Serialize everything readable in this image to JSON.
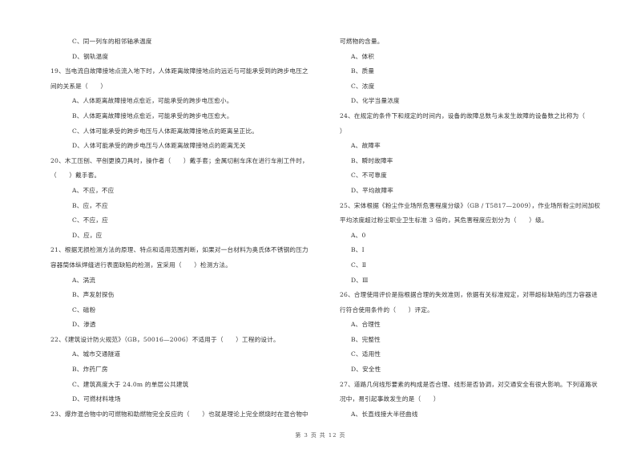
{
  "left_column": [
    {
      "type": "option",
      "text": "C、同一列车的相邻轴承温度"
    },
    {
      "type": "option",
      "text": "D、钢轨温度"
    },
    {
      "type": "question",
      "text": "19、当电流自故障接地点流入地下时，人体距离故障接地点的远近与可能承受到的跨步电压之"
    },
    {
      "type": "question",
      "text": "间的关系是（　　）"
    },
    {
      "type": "option",
      "text": "A、人体距离故障接地点愈近，可能承受的跨步电压愈小。"
    },
    {
      "type": "option",
      "text": "B、人体距离故障接地点愈近，可能承受的跨步电压愈大。"
    },
    {
      "type": "option",
      "text": "C、人体可能承受的跨步电压与人体距离故障接地点的距离呈正比。"
    },
    {
      "type": "option",
      "text": "D、人体可能承受的跨步电压与人体距离故障接地点的距离无关"
    },
    {
      "type": "question",
      "text": "20、木工压刨、平刨更换刀具时，操作者（　　）戴手套；金属切削车床在进行车削工件时，"
    },
    {
      "type": "question",
      "text": "（　　）戴手套。"
    },
    {
      "type": "option",
      "text": "A、不应，不应"
    },
    {
      "type": "option",
      "text": "B、应，不应"
    },
    {
      "type": "option",
      "text": "C、不应，应"
    },
    {
      "type": "option",
      "text": "D、应，应"
    },
    {
      "type": "question",
      "text": "21、根据无损检测方法的原理、特点和适用范围判断，如果对一台材料为奥氏体不锈钢的压力"
    },
    {
      "type": "question",
      "text": "容器筒体纵焊缝进行表面缺陷的检测，宜采用（　　）检测方法。"
    },
    {
      "type": "option",
      "text": "A、涡流"
    },
    {
      "type": "option",
      "text": "B、声发射探伤"
    },
    {
      "type": "option",
      "text": "C、磁粉"
    },
    {
      "type": "option",
      "text": "D、渗透"
    },
    {
      "type": "question",
      "text": "22、《建筑设计防火规范》（GB，50016—2006）不适用于（　　）工程的设计。"
    },
    {
      "type": "option",
      "text": "A、城市交通隧道"
    },
    {
      "type": "option",
      "text": "B、炸药厂房"
    },
    {
      "type": "option",
      "text": "C、建筑高度大于 24.0m 的单层公共建筑"
    },
    {
      "type": "option",
      "text": "D、可燃材料堆场"
    },
    {
      "type": "question",
      "text": "23、爆炸混合物中的可燃物和助燃物完全反应的（　　）也就是理论上完全燃烧时在混合物中"
    }
  ],
  "right_column": [
    {
      "type": "question",
      "text": "可燃物的含量。"
    },
    {
      "type": "option",
      "text": "A、体积"
    },
    {
      "type": "option",
      "text": "B、质量"
    },
    {
      "type": "option",
      "text": "C、浓度"
    },
    {
      "type": "option",
      "text": "D、化学当量浓度"
    },
    {
      "type": "question",
      "text": "24、在规定的条件下和规定的时间内，设备的故障总数与未发生故障的设备数之比称为（"
    },
    {
      "type": "question",
      "text": "）"
    },
    {
      "type": "option",
      "text": "A、故障率"
    },
    {
      "type": "option",
      "text": "B、瞬时故障率"
    },
    {
      "type": "option",
      "text": "C、不可靠度"
    },
    {
      "type": "option",
      "text": "D、平均故障率"
    },
    {
      "type": "question",
      "text": "25、宋体根据《粉尘作业场所危害程度分级》（GB / T5817—2009），作业场所粉尘时间加权"
    },
    {
      "type": "question",
      "text": "平均浓度超过粉尘职业卫生标准 3 倍的，其危害程度应划分为（　　）级。"
    },
    {
      "type": "option",
      "text": "A、0"
    },
    {
      "type": "option",
      "text": "B、Ⅰ"
    },
    {
      "type": "option",
      "text": "C、Ⅱ"
    },
    {
      "type": "option",
      "text": "D、Ⅲ"
    },
    {
      "type": "question",
      "text": "26、合理使用评价是指根据合理的失效准则，依据有关标准规定，对带超标缺陷的压力容器进"
    },
    {
      "type": "question",
      "text": "行符合使用条件的（　　）评定。"
    },
    {
      "type": "option",
      "text": "A、合理性"
    },
    {
      "type": "option",
      "text": "B、完整性"
    },
    {
      "type": "option",
      "text": "C、适用性"
    },
    {
      "type": "option",
      "text": "D、安全性"
    },
    {
      "type": "question",
      "text": "27、道路几何线形要素的构成是否合理、线形是否协调，对交通安全有很大影响。下列道路状"
    },
    {
      "type": "question",
      "text": "况中，易引起事故发生的是（　　）"
    },
    {
      "type": "option",
      "text": "A、长直线接大半径曲线"
    }
  ],
  "footer": {
    "page_label": "第 3 页 共 12 页"
  }
}
